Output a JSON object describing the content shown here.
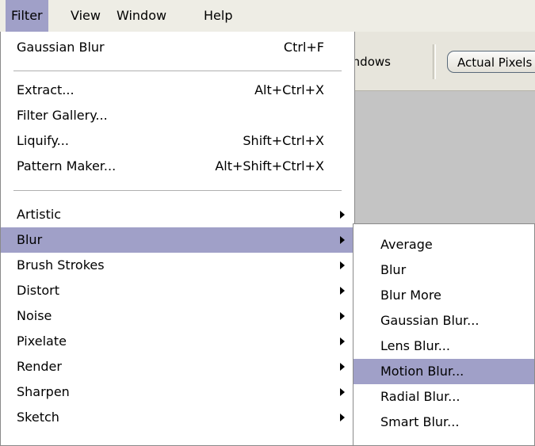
{
  "menubar": {
    "items": [
      "Filter",
      "View",
      "Window",
      "Help"
    ]
  },
  "toolbar": {
    "windows_label": "Windows",
    "actual_pixels_label": "Actual Pixels"
  },
  "filter_menu": {
    "items": [
      {
        "label": "Gaussian Blur",
        "shortcut": "Ctrl+F"
      },
      {
        "label": "Extract...",
        "shortcut": "Alt+Ctrl+X"
      },
      {
        "label": "Filter Gallery...",
        "shortcut": ""
      },
      {
        "label": "Liquify...",
        "shortcut": "Shift+Ctrl+X"
      },
      {
        "label": "Pattern Maker...",
        "shortcut": "Alt+Shift+Ctrl+X"
      },
      {
        "label": "Artistic"
      },
      {
        "label": "Blur"
      },
      {
        "label": "Brush Strokes"
      },
      {
        "label": "Distort"
      },
      {
        "label": "Noise"
      },
      {
        "label": "Pixelate"
      },
      {
        "label": "Render"
      },
      {
        "label": "Sharpen"
      },
      {
        "label": "Sketch"
      }
    ]
  },
  "blur_submenu": {
    "items": [
      {
        "label": "Average"
      },
      {
        "label": "Blur"
      },
      {
        "label": "Blur More"
      },
      {
        "label": "Gaussian Blur..."
      },
      {
        "label": "Lens Blur..."
      },
      {
        "label": "Motion Blur..."
      },
      {
        "label": "Radial Blur..."
      },
      {
        "label": "Smart Blur..."
      }
    ]
  },
  "colors": {
    "highlight": "#a0a0c8",
    "menubar_bg": "#eeede5",
    "workspace_bg": "#c4c4c4"
  }
}
